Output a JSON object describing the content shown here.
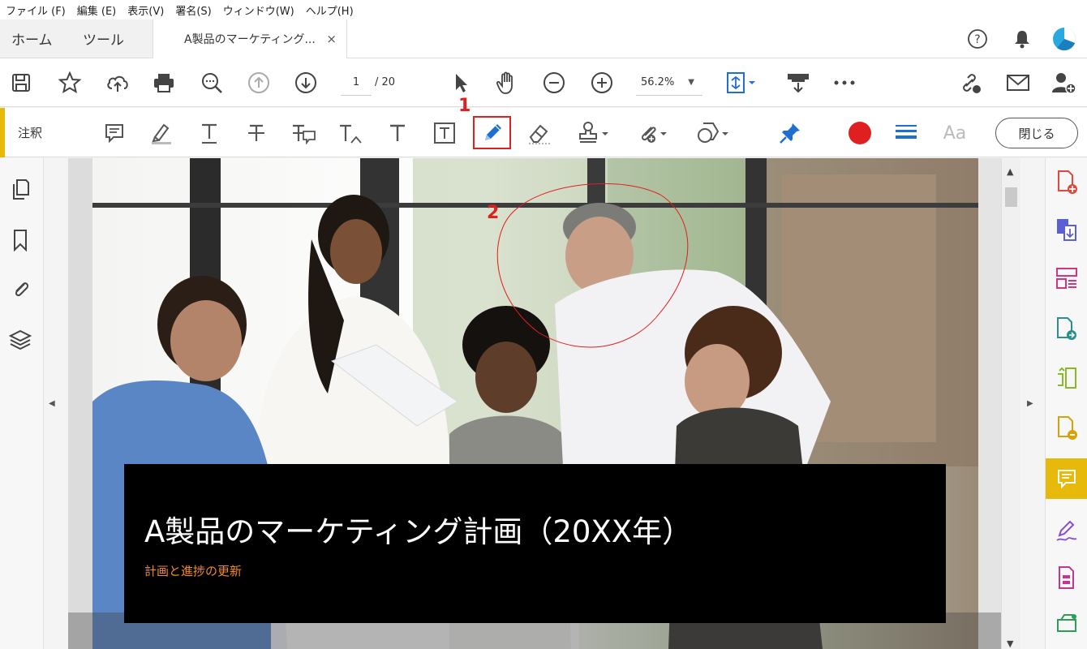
{
  "menu": {
    "items": [
      "ファイル (F)",
      "編集 (E)",
      "表示(V)",
      "署名(S)",
      "ウィンドウ(W)",
      "ヘルプ(H)"
    ]
  },
  "tabs": {
    "home": "ホーム",
    "tools": "ツール",
    "document": "A製品のマーケティング...",
    "close": "×"
  },
  "toolbar": {
    "page_current": "1",
    "page_total": "/ 20",
    "zoom": "56.2%"
  },
  "annotation_bar": {
    "label": "注釈",
    "close_button": "閉じる",
    "font_label": "Aa",
    "step1": "1",
    "step2": "2"
  },
  "slide": {
    "title": "A製品のマーケティング計画（20XX年）",
    "subtitle": "計画と進捗の更新"
  },
  "colors": {
    "accent_yellow": "#e7b90a",
    "highlight_red": "#e0201c",
    "pencil_blue": "#1f6fd1",
    "subtitle_orange": "#f08a24",
    "record_red": "#e02020"
  },
  "icons": {
    "toolbar": [
      "save-icon",
      "star-icon",
      "cloud-upload-icon",
      "print-icon",
      "zoom-search-icon",
      "page-up-icon",
      "page-down-icon",
      "select-arrow-icon",
      "hand-icon",
      "zoom-out-icon",
      "zoom-in-icon",
      "fit-page-icon",
      "scan-icon",
      "more-icon",
      "share-link-icon",
      "email-icon",
      "add-user-icon"
    ],
    "annotation": [
      "sticky-note-icon",
      "highlight-icon",
      "underline-text-icon",
      "strikethrough-text-icon",
      "replace-text-icon",
      "insert-text-icon",
      "add-text-icon",
      "text-box-icon",
      "pencil-draw-icon",
      "eraser-icon",
      "stamp-icon",
      "attach-file-icon",
      "shape-icon",
      "pin-icon",
      "color-circle-icon",
      "line-weight-icon"
    ],
    "left_rail": [
      "pages-icon",
      "bookmark-icon",
      "attachment-icon",
      "layers-icon"
    ],
    "right_rail": [
      "create-pdf-icon",
      "combine-files-icon",
      "organize-pages-icon",
      "export-pdf-icon",
      "edit-pdf-icon",
      "request-signature-icon",
      "comment-icon",
      "fill-sign-icon",
      "compress-pdf-icon",
      "scan-ocr-icon"
    ]
  }
}
